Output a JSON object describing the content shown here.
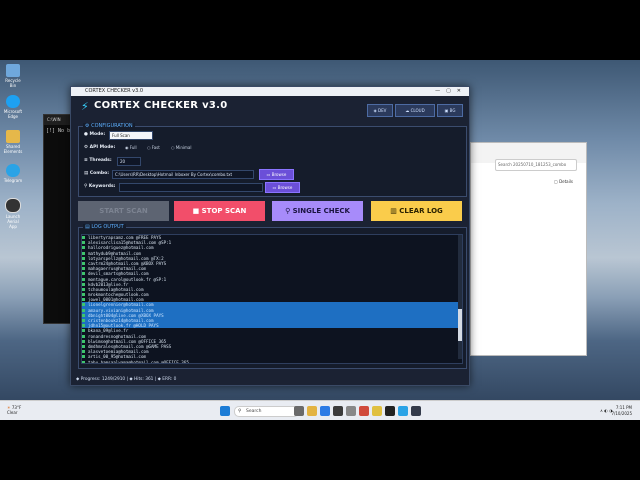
{
  "desktop": {
    "icons": [
      {
        "label": "Recycle Bin",
        "color": "#6fa8dc"
      },
      {
        "label": "Microsoft Edge",
        "color": "#1da1f2"
      },
      {
        "label": "Shared Elements",
        "color": "#e6b84a"
      },
      {
        "label": "Telegram",
        "color": "#2aa3e6"
      },
      {
        "label": "Launch Aerial App",
        "color": "#333333"
      }
    ]
  },
  "console": {
    "title": "C:\\WIN",
    "text": "[!] No b"
  },
  "explorer": {
    "search": "Search 20250710_181253_combo",
    "details": "Details"
  },
  "app": {
    "window_title": "CORTEX CHECKER v3.0",
    "brand": "CORTEX CHECKER v3.0",
    "header_buttons": [
      "DEV",
      "CLOUD",
      "BG"
    ],
    "config": {
      "title": "CONFIGURATION",
      "mode_label": "Mode:",
      "mode_value": "Full Scan",
      "api_label": "API Mode:",
      "api_options": [
        "Full",
        "Fast",
        "Minimal"
      ],
      "threads_label": "Threads:",
      "threads_value": "20",
      "combo_label": "Combo:",
      "combo_value": "C:\\Users\\RR\\Desktop\\Hotmail Inboxer By Cortex\\combo.txt",
      "keywords_label": "Keywords:",
      "keywords_value": "",
      "browse_label": "Browse"
    },
    "actions": {
      "start": "START SCAN",
      "stop": "STOP SCAN",
      "single": "SINGLE CHECK",
      "clear": "CLEAR LOG"
    },
    "log": {
      "title": "LOG OUTPUT",
      "lines": [
        {
          "text": "libertyrapsamz.com @FREE PAYS",
          "selected": false
        },
        {
          "text": "alexisarclisa15@hotmail.com @SP:1",
          "selected": false
        },
        {
          "text": "hallorodriguez@hotmail.com",
          "selected": false
        },
        {
          "text": "mathydub9@hotmail.com",
          "selected": false
        },
        {
          "text": "lotyarspellz@hotmail.com @TX:2",
          "selected": false
        },
        {
          "text": "cavtrm24@hotmail.com @XBOX PAYS",
          "selected": false
        },
        {
          "text": "mahagaerrus@hotmail.com",
          "selected": false
        },
        {
          "text": "devil_smarts@hotmail.com",
          "selected": false
        },
        {
          "text": "montague.carol@outlook.fr @SP:1",
          "selected": false
        },
        {
          "text": "kdvb2013@live.fr",
          "selected": false
        },
        {
          "text": "tchoumoula@hotmail.com",
          "selected": false
        },
        {
          "text": "mrokmontoche@outlook.com",
          "selected": false
        },
        {
          "text": "jowel_0001@hotmail.com",
          "selected": false
        },
        {
          "text": "lionelgrennier@hotmail.com",
          "selected": true
        },
        {
          "text": "amaury.viviani@hotmail.com",
          "selected": true
        },
        {
          "text": "dbnight004@live.com @XBOX PAYS",
          "selected": true
        },
        {
          "text": "cristenboukz14@hotmail.com",
          "selected": true
        },
        {
          "text": "jdhn15@outlook.fr @HOLD PAYS",
          "selected": true
        },
        {
          "text": "bkana_09@live.fr",
          "selected": false
        },
        {
          "text": "ronandresno@hotmail.com",
          "selected": false
        },
        {
          "text": "blwimse@hotmail.com @OFFICE 365",
          "selected": false
        },
        {
          "text": "dmdhmrales@hotmail.com @GAME PASS",
          "selected": false
        },
        {
          "text": "alasvetoemia@hotmail.com",
          "selected": false
        },
        {
          "text": "artis_00_95@hotmail.com",
          "selected": false
        },
        {
          "text": "tabu_hamsaalyama@hotmail.com @OFFICE 365",
          "selected": false
        }
      ]
    },
    "status": {
      "progress": "Progress: 1249/2910",
      "hits": "Hits: 361",
      "errors": "ERR: 0"
    }
  },
  "taskbar": {
    "weather_temp": "73°F",
    "weather_desc": "Clear",
    "search": "Search",
    "time": "7:11 PM",
    "date": "7/10/2025"
  }
}
